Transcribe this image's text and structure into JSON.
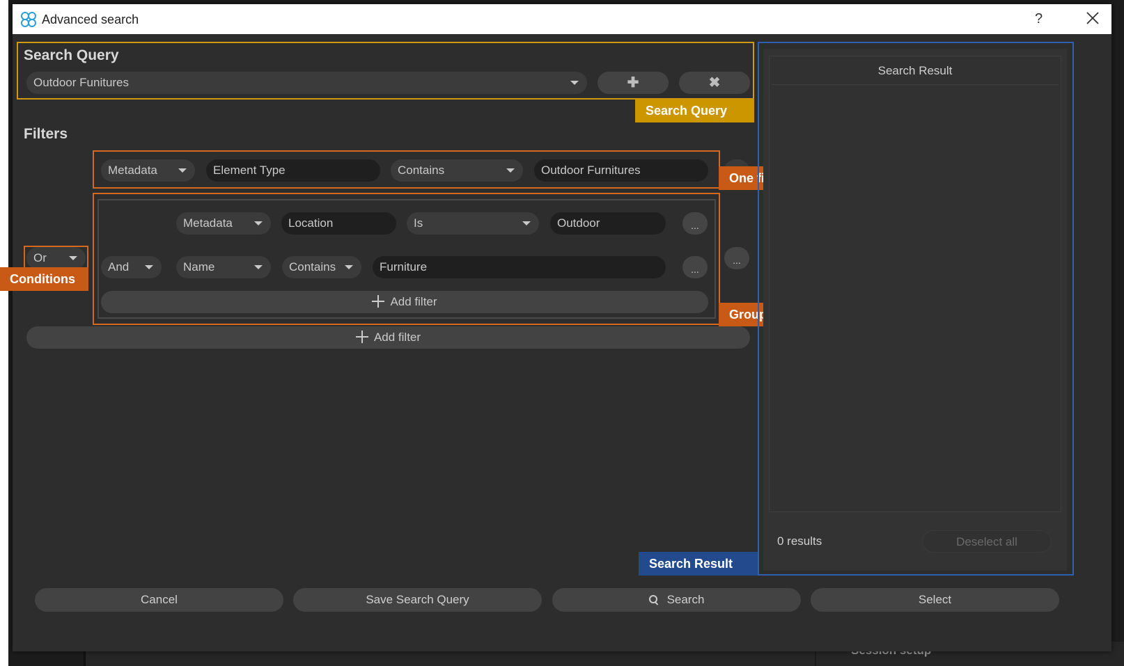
{
  "window": {
    "title": "Advanced search",
    "help_label": "?"
  },
  "background": {
    "session_label": "Session setup"
  },
  "search_query": {
    "heading": "Search Query",
    "selected": "Outdoor Funitures",
    "add_label": "✚",
    "remove_label": "✖"
  },
  "filters": {
    "heading": "Filters",
    "condition": "Or",
    "single_filter": {
      "source": "Metadata",
      "field": "Element Type",
      "operator": "Contains",
      "value": "Outdoor Furnitures"
    },
    "group": {
      "rows": [
        {
          "source": "Metadata",
          "field": "Location",
          "operator": "Is",
          "value": "Outdoor",
          "more": "..."
        },
        {
          "conjunction": "And",
          "field": "Name",
          "operator": "Contains",
          "value": "Furniture",
          "more": "..."
        }
      ],
      "add_filter_label": "Add filter",
      "more": "..."
    },
    "add_filter_label": "Add filter"
  },
  "annotations": {
    "search_query": "Search Query",
    "one_filter": "One filter",
    "conditions": "Conditions",
    "group_of_filters": "Group of filters",
    "search_result": "Search Result"
  },
  "results": {
    "header": "Search Result",
    "count": "0 results",
    "deselect_label": "Deselect all"
  },
  "footer": {
    "cancel": "Cancel",
    "save": "Save Search Query",
    "search": "Search",
    "select": "Select"
  },
  "colors": {
    "annotation_yellow": "#cc9600",
    "annotation_orange": "#c95a15",
    "annotation_blue": "#234a8c",
    "dialog_bg": "#2d2d2d"
  }
}
